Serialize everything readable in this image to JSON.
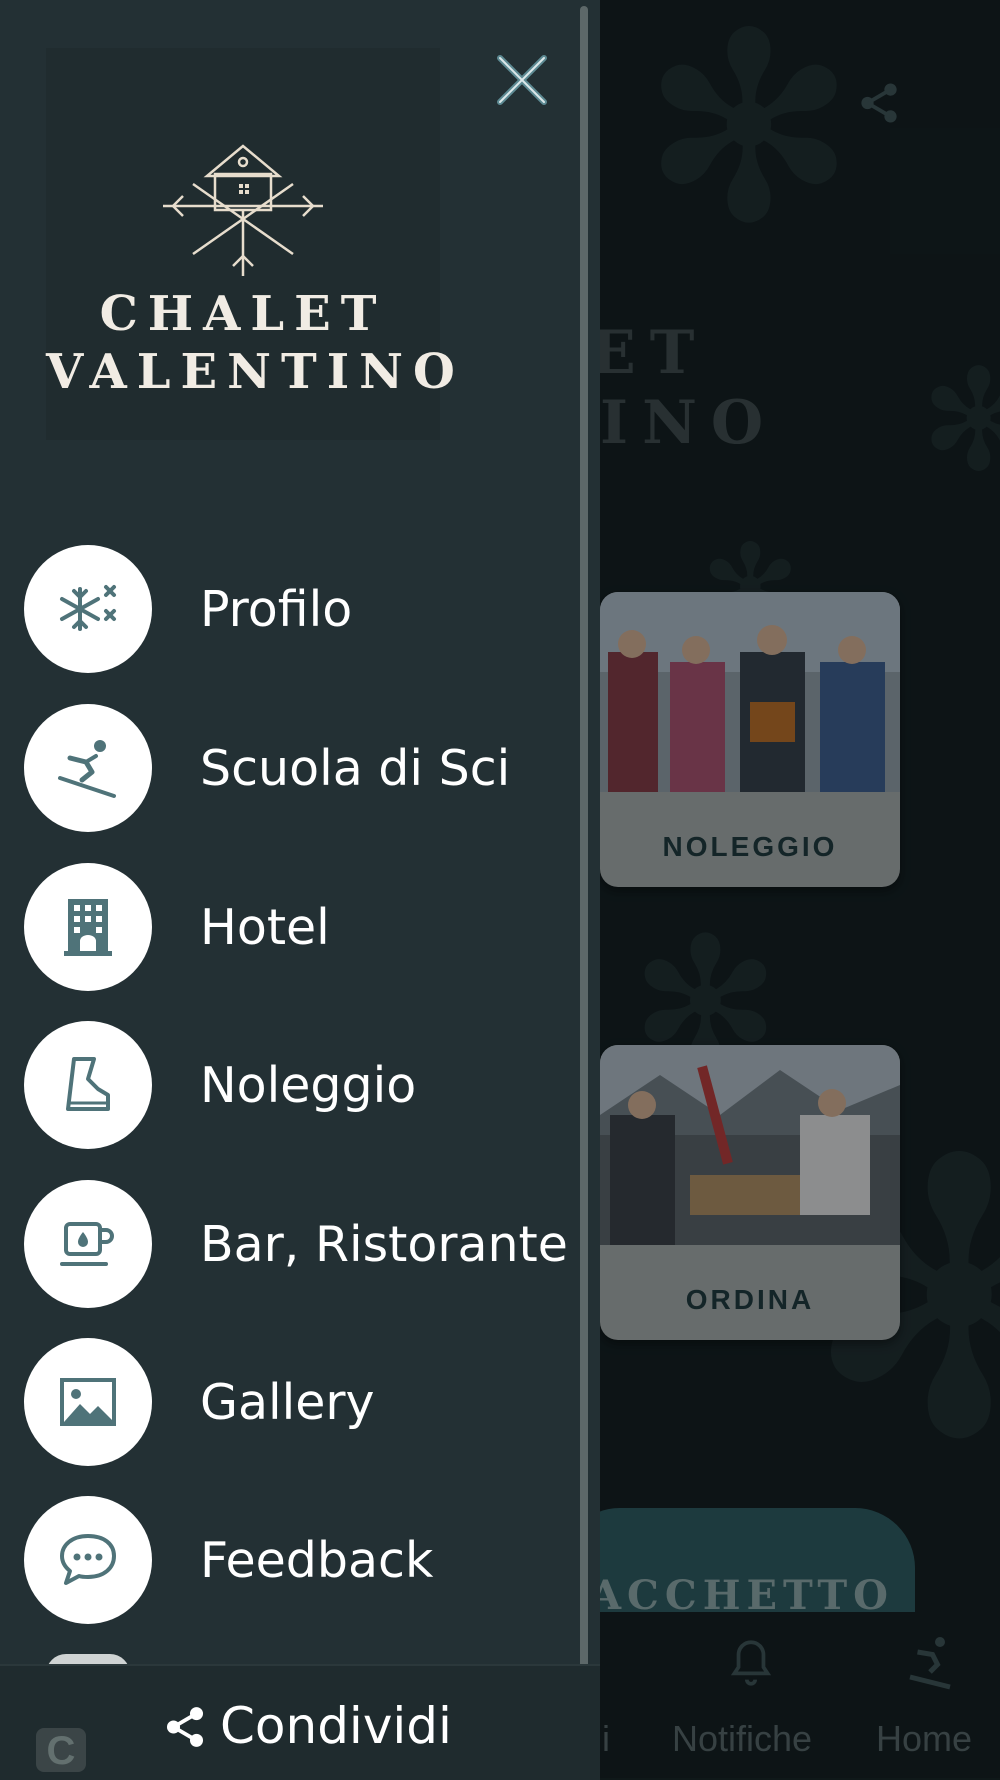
{
  "drawer": {
    "brand_line1": "CHALET",
    "brand_line2": "VALENTINO",
    "close_icon": "close-icon",
    "menu_items": [
      {
        "label": "Profilo",
        "icon": "snowflake-icon"
      },
      {
        "label": "Scuola di Sci",
        "icon": "skier-icon"
      },
      {
        "label": "Hotel",
        "icon": "hotel-icon"
      },
      {
        "label": "Noleggio",
        "icon": "ski-boot-icon"
      },
      {
        "label": "Bar, Ristorante",
        "icon": "coffee-cup-icon"
      },
      {
        "label": "Gallery",
        "icon": "image-icon"
      },
      {
        "label": "Feedback",
        "icon": "chat-bubble-icon"
      }
    ],
    "footer": {
      "share_label": "Condividi",
      "share_icon": "share-icon"
    }
  },
  "background": {
    "title_line1": "ET",
    "title_line2": "INO",
    "cards": [
      {
        "caption": "NOLEGGIO"
      },
      {
        "caption": "ORDINA"
      }
    ],
    "banner_text": "ACCHETTO",
    "tabbar": [
      {
        "label": "ni"
      },
      {
        "label": "Notifiche",
        "icon": "bell-icon"
      },
      {
        "label": "Home",
        "icon": "skier-icon"
      }
    ]
  },
  "colors": {
    "drawer_bg": "#233034",
    "accent": "#4f7379",
    "text": "#ffffff"
  }
}
